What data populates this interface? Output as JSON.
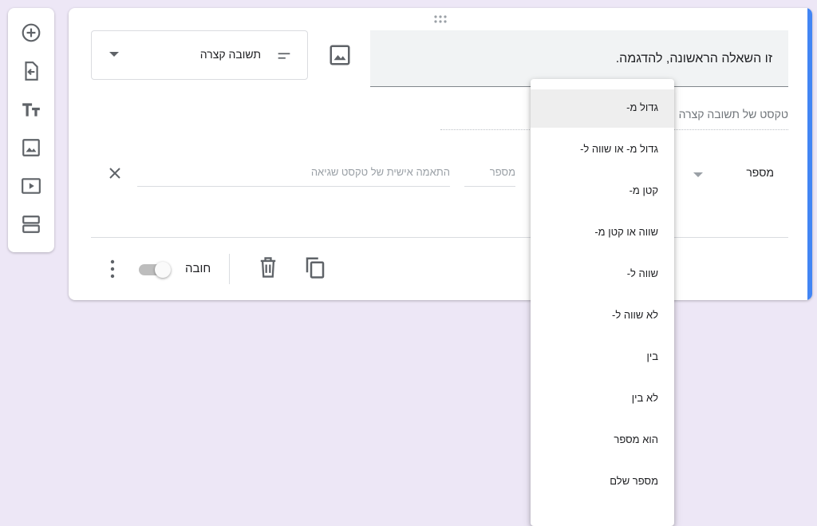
{
  "toolbar": {
    "add_question_icon": "add-circle-icon",
    "import_questions_icon": "import-icon",
    "add_title_icon": "title-text-icon",
    "add_image_icon": "image-icon",
    "add_video_icon": "video-icon",
    "add_section_icon": "section-icon"
  },
  "question": {
    "title": "זו השאלה הראשונה, להדגמה.",
    "type_label": "תשובה קצרה",
    "answer_hint": "טקסט של תשובה קצרה"
  },
  "validation": {
    "type": "מספר",
    "number_placeholder": "מספר",
    "error_placeholder": "התאמה אישית של טקסט שגיאה"
  },
  "footer": {
    "required_label": "חובה",
    "required_enabled": false
  },
  "dropdown": {
    "items": [
      "גדול מ-",
      "גדול מ- או שווה ל-",
      "קטן מ-",
      "שווה או קטן מ-",
      "שווה ל-",
      "לא שווה ל-",
      "בין",
      "לא בין",
      "הוא מספר",
      "מספר שלם"
    ],
    "highlighted_index": 0
  },
  "colors": {
    "background": "#ede7f6",
    "accent": "#4285f4"
  }
}
